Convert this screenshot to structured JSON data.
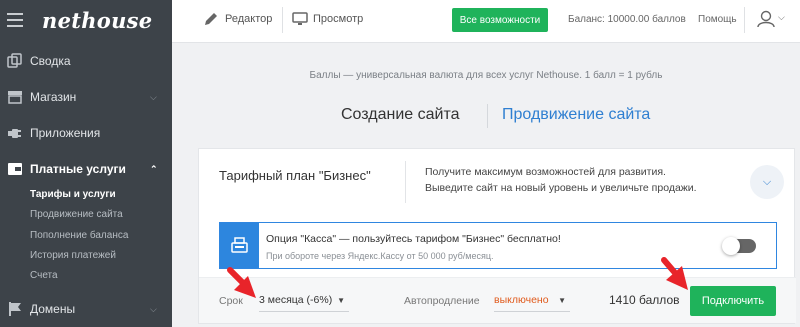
{
  "brand": {
    "logo": "nethouse"
  },
  "sidebar": {
    "items": [
      {
        "label": "Сводка",
        "icon": "copy-icon"
      },
      {
        "label": "Магазин",
        "icon": "store-icon",
        "chevron": "⌄"
      },
      {
        "label": "Приложения",
        "icon": "plug-icon"
      },
      {
        "label": "Платные услуги",
        "icon": "wallet-icon",
        "chevron": "⌃"
      },
      {
        "label": "Домены",
        "icon": "flag-icon",
        "chevron": "⌄"
      }
    ],
    "subitems": [
      "Тарифы и услуги",
      "Продвижение сайта",
      "Пополнение баланса",
      "История платежей",
      "Счета"
    ]
  },
  "topbar": {
    "editor": "Редактор",
    "preview": "Просмотр",
    "all_features": "Все возможности",
    "balance": "Баланс: 10000.00 баллов",
    "help": "Помощь"
  },
  "info": "Баллы — универсальная валюта для всех услуг Nethouse. 1 балл = 1 рубль",
  "tabs": {
    "create": "Создание сайта",
    "promote": "Продвижение сайта"
  },
  "plan": {
    "title": "Тарифный план \"Бизнес\"",
    "desc1": "Получите максимум возможностей для развития.",
    "desc2": "Выведите сайт на новый уровень и увеличьте продажи."
  },
  "kassa": {
    "title": "Опция \"Касса\" — пользуйтесь тарифом \"Бизнес\" бесплатно!",
    "subtitle": "При обороте через Яндекс.Кассу от 50 000 руб/месяц.",
    "enabled": false
  },
  "order": {
    "term_label": "Срок",
    "term_value": "3 месяца (-6%)",
    "autorenew_label": "Автопродление",
    "autorenew_value": "выключено",
    "price": "1410 баллов",
    "connect": "Подключить"
  },
  "colors": {
    "green": "#1fb35b",
    "blue": "#2d86de",
    "sidebar": "#3d4349",
    "link": "#2f7fd1",
    "red": "#e05a1c",
    "arrow": "#e8242a"
  }
}
